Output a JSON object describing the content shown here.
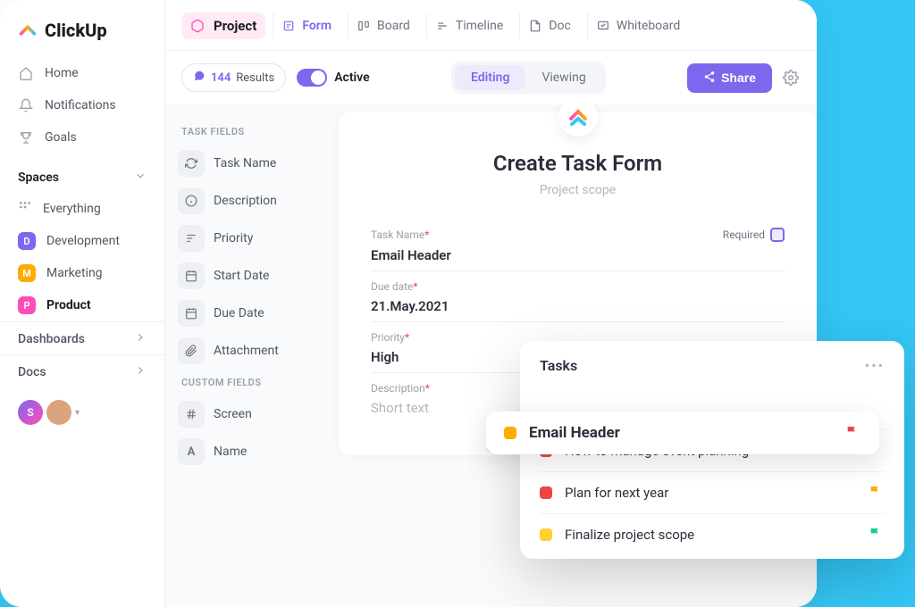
{
  "brand": "ClickUp",
  "sidebar": {
    "nav": [
      {
        "label": "Home"
      },
      {
        "label": "Notifications"
      },
      {
        "label": "Goals"
      }
    ],
    "spaces_label": "Spaces",
    "everything": "Everything",
    "spaces": [
      {
        "letter": "D",
        "label": "Development"
      },
      {
        "letter": "M",
        "label": "Marketing"
      },
      {
        "letter": "P",
        "label": "Product"
      }
    ],
    "dashboards": "Dashboards",
    "docs": "Docs",
    "avatar_letter": "S"
  },
  "header": {
    "project": "Project",
    "tabs": [
      {
        "label": "Form"
      },
      {
        "label": "Board"
      },
      {
        "label": "Timeline"
      },
      {
        "label": "Doc"
      },
      {
        "label": "Whiteboard"
      }
    ]
  },
  "toolbar": {
    "results_count": "144",
    "results_label": "Results",
    "active": "Active",
    "editing": "Editing",
    "viewing": "Viewing",
    "share": "Share"
  },
  "fields": {
    "task_header": "TASK FIELDS",
    "task": [
      {
        "label": "Task Name"
      },
      {
        "label": "Description"
      },
      {
        "label": "Priority"
      },
      {
        "label": "Start Date"
      },
      {
        "label": "Due Date"
      },
      {
        "label": "Attachment"
      }
    ],
    "custom_header": "CUSTOM FIELDS",
    "custom": [
      {
        "label": "Screen"
      },
      {
        "label": "Name"
      }
    ]
  },
  "form": {
    "title": "Create Task Form",
    "subtitle": "Project scope",
    "required_label": "Required",
    "rows": {
      "task_name": {
        "label": "Task Name",
        "value": "Email Header"
      },
      "due_date": {
        "label": "Due date",
        "value": "21.May.2021"
      },
      "priority": {
        "label": "Priority",
        "value": "High"
      },
      "description": {
        "label": "Description",
        "placeholder": "Short text"
      }
    }
  },
  "tasks_popup": {
    "title": "Tasks",
    "items": [
      {
        "name": "Email Header",
        "color": "s-or",
        "flag": "#EF4444"
      },
      {
        "name": "How to manage event planning",
        "color": "s-rd",
        "flag": "#EF4444"
      },
      {
        "name": "Plan for next year",
        "color": "s-rd",
        "flag": "#FFAB00"
      },
      {
        "name": "Finalize project scope",
        "color": "s-yl",
        "flag": "#14CC9E"
      }
    ]
  }
}
